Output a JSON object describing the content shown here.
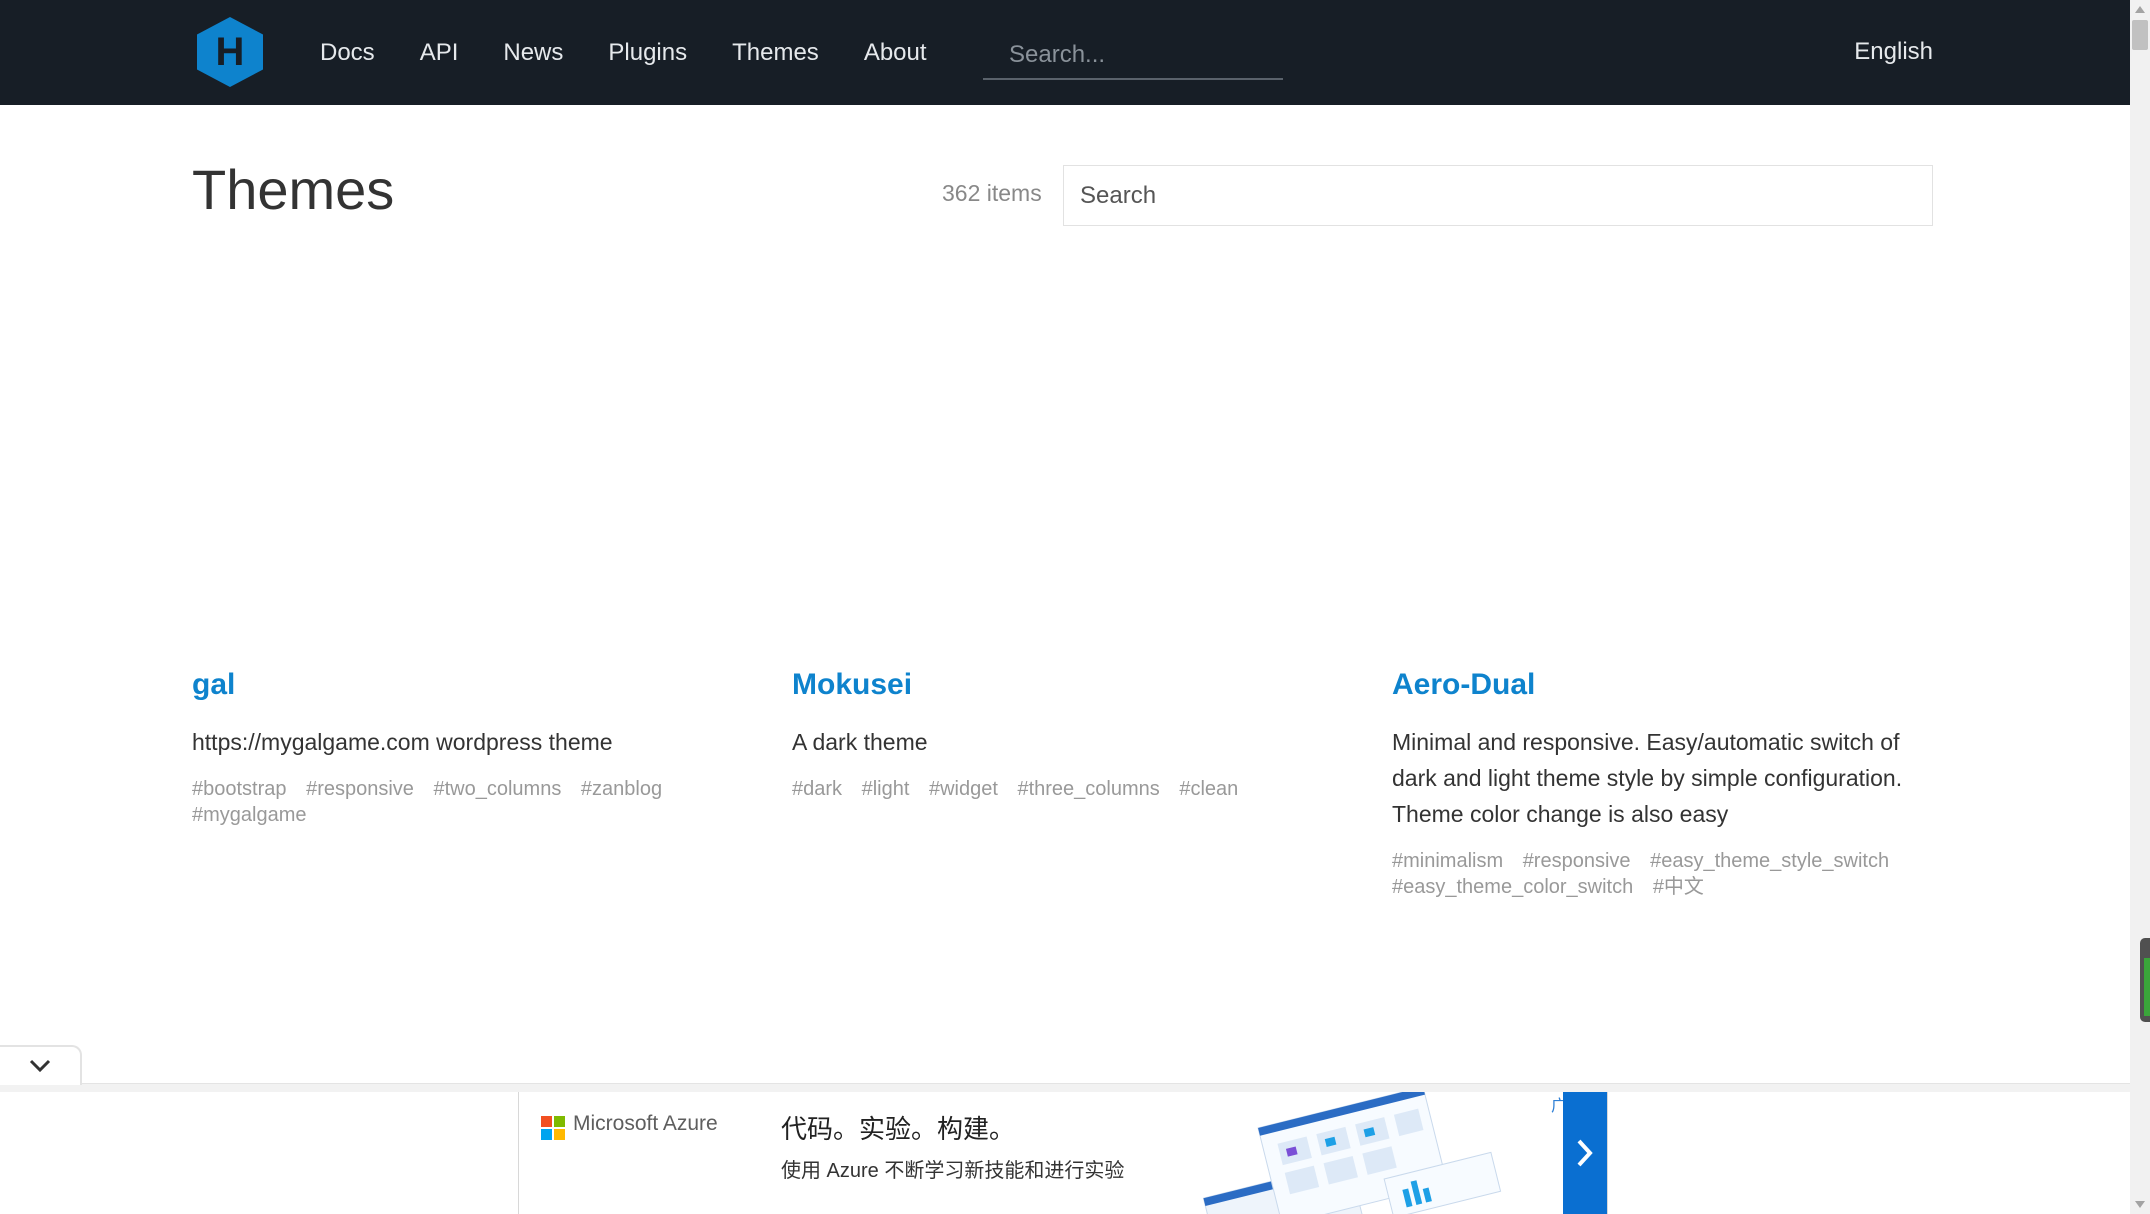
{
  "header": {
    "logo_letter": "H",
    "nav": [
      "Docs",
      "API",
      "News",
      "Plugins",
      "Themes",
      "About"
    ],
    "search_placeholder": "Search...",
    "language": "English"
  },
  "main": {
    "title": "Themes",
    "count": "362 items",
    "search_placeholder": "Search"
  },
  "themes": [
    {
      "name": "gal",
      "description": "https://mygalgame.com wordpress theme",
      "tags": [
        "#bootstrap",
        "#responsive",
        "#two_columns",
        "#zanblog",
        "#mygalgame"
      ]
    },
    {
      "name": "Mokusei",
      "description": "A dark theme",
      "tags": [
        "#dark",
        "#light",
        "#widget",
        "#three_columns",
        "#clean"
      ]
    },
    {
      "name": "Aero-Dual",
      "description": "Minimal and responsive. Easy/automatic switch of dark and light theme style by simple configuration. Theme color change is also easy",
      "tags": [
        "#minimalism",
        "#responsive",
        "#easy_theme_style_switch",
        "#easy_theme_color_switch",
        "#中文"
      ]
    }
  ],
  "ad": {
    "brand": "Microsoft Azure",
    "headline": "代码。实验。构建。",
    "subline": "使用 Azure 不断学习新技能和进行实验",
    "label": "广告"
  },
  "icons": {
    "collapse": "chevron-down-icon",
    "ad_next": "chevron-right-icon",
    "logo": "hexagon-logo-icon"
  },
  "colors": {
    "header_bg": "#171e26",
    "link_blue": "#0e83cd",
    "tag_gray": "#999999",
    "ad_blue": "#0a6fd1"
  }
}
